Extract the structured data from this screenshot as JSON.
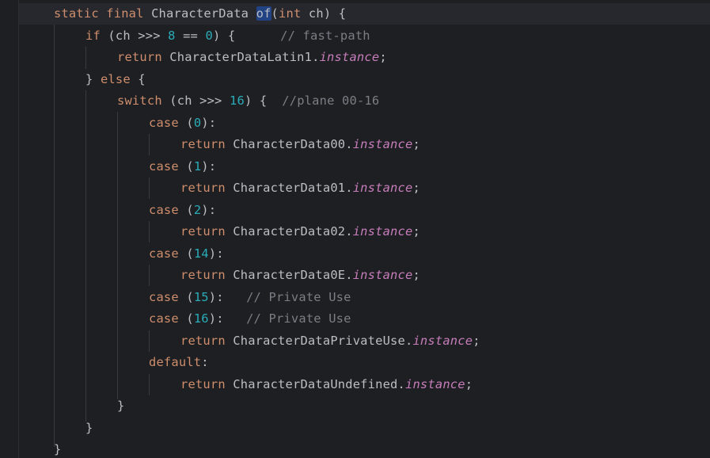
{
  "editor": {
    "lines": [
      {
        "indent": 68,
        "tokens": [
          {
            "t": "static",
            "c": "kw"
          },
          {
            "t": " "
          },
          {
            "t": "final",
            "c": "kw"
          },
          {
            "t": " CharacterData "
          },
          {
            "t": "of",
            "c": "hl"
          },
          {
            "t": "("
          },
          {
            "t": "int",
            "c": "kw"
          },
          {
            "t": " ch) {"
          }
        ]
      },
      {
        "indent": 108,
        "tokens": [
          {
            "t": "if",
            "c": "kw"
          },
          {
            "t": " (ch >>> "
          },
          {
            "t": "8",
            "c": "num"
          },
          {
            "t": " == "
          },
          {
            "t": "0",
            "c": "num"
          },
          {
            "t": ") {      "
          },
          {
            "t": "// fast-path",
            "c": "cm"
          }
        ]
      },
      {
        "indent": 148,
        "tokens": [
          {
            "t": "return",
            "c": "kw"
          },
          {
            "t": " CharacterDataLatin1."
          },
          {
            "t": "instance",
            "c": "fld"
          },
          {
            "t": ";"
          }
        ]
      },
      {
        "indent": 108,
        "tokens": [
          {
            "t": "} "
          },
          {
            "t": "else",
            "c": "kw"
          },
          {
            "t": " {"
          }
        ]
      },
      {
        "indent": 148,
        "tokens": [
          {
            "t": "switch",
            "c": "kw"
          },
          {
            "t": " (ch >>> "
          },
          {
            "t": "16",
            "c": "num"
          },
          {
            "t": ") {  "
          },
          {
            "t": "//plane 00-16",
            "c": "cm"
          }
        ]
      },
      {
        "indent": 188,
        "tokens": [
          {
            "t": "case",
            "c": "kw"
          },
          {
            "t": " ("
          },
          {
            "t": "0",
            "c": "num"
          },
          {
            "t": "):"
          }
        ]
      },
      {
        "indent": 228,
        "tokens": [
          {
            "t": "return",
            "c": "kw"
          },
          {
            "t": " CharacterData00."
          },
          {
            "t": "instance",
            "c": "fld"
          },
          {
            "t": ";"
          }
        ]
      },
      {
        "indent": 188,
        "tokens": [
          {
            "t": "case",
            "c": "kw"
          },
          {
            "t": " ("
          },
          {
            "t": "1",
            "c": "num"
          },
          {
            "t": "):"
          }
        ]
      },
      {
        "indent": 228,
        "tokens": [
          {
            "t": "return",
            "c": "kw"
          },
          {
            "t": " CharacterData01."
          },
          {
            "t": "instance",
            "c": "fld"
          },
          {
            "t": ";"
          }
        ]
      },
      {
        "indent": 188,
        "tokens": [
          {
            "t": "case",
            "c": "kw"
          },
          {
            "t": " ("
          },
          {
            "t": "2",
            "c": "num"
          },
          {
            "t": "):"
          }
        ]
      },
      {
        "indent": 228,
        "tokens": [
          {
            "t": "return",
            "c": "kw"
          },
          {
            "t": " CharacterData02."
          },
          {
            "t": "instance",
            "c": "fld"
          },
          {
            "t": ";"
          }
        ]
      },
      {
        "indent": 188,
        "tokens": [
          {
            "t": "case",
            "c": "kw"
          },
          {
            "t": " ("
          },
          {
            "t": "14",
            "c": "num"
          },
          {
            "t": "):"
          }
        ]
      },
      {
        "indent": 228,
        "tokens": [
          {
            "t": "return",
            "c": "kw"
          },
          {
            "t": " CharacterData0E."
          },
          {
            "t": "instance",
            "c": "fld"
          },
          {
            "t": ";"
          }
        ]
      },
      {
        "indent": 188,
        "tokens": [
          {
            "t": "case",
            "c": "kw"
          },
          {
            "t": " ("
          },
          {
            "t": "15",
            "c": "num"
          },
          {
            "t": "):   "
          },
          {
            "t": "// Private Use",
            "c": "cm"
          }
        ]
      },
      {
        "indent": 188,
        "tokens": [
          {
            "t": "case",
            "c": "kw"
          },
          {
            "t": " ("
          },
          {
            "t": "16",
            "c": "num"
          },
          {
            "t": "):   "
          },
          {
            "t": "// Private Use",
            "c": "cm"
          }
        ]
      },
      {
        "indent": 228,
        "tokens": [
          {
            "t": "return",
            "c": "kw"
          },
          {
            "t": " CharacterDataPrivateUse."
          },
          {
            "t": "instance",
            "c": "fld"
          },
          {
            "t": ";"
          }
        ]
      },
      {
        "indent": 188,
        "tokens": [
          {
            "t": "default",
            "c": "kw"
          },
          {
            "t": ":"
          }
        ]
      },
      {
        "indent": 228,
        "tokens": [
          {
            "t": "return",
            "c": "kw"
          },
          {
            "t": " CharacterDataUndefined."
          },
          {
            "t": "instance",
            "c": "fld"
          },
          {
            "t": ";"
          }
        ]
      },
      {
        "indent": 148,
        "tokens": [
          {
            "t": "}"
          }
        ]
      },
      {
        "indent": 108,
        "tokens": [
          {
            "t": "}"
          }
        ]
      },
      {
        "indent": 68,
        "tokens": [
          {
            "t": "}"
          }
        ]
      }
    ]
  },
  "colors": {
    "background": "#1e1f22",
    "text": "#bcbec4",
    "keyword": "#cf8e6d",
    "number": "#2aacb8",
    "comment": "#7a7e85",
    "field": "#c77dbb",
    "usage_highlight": "#214283"
  }
}
